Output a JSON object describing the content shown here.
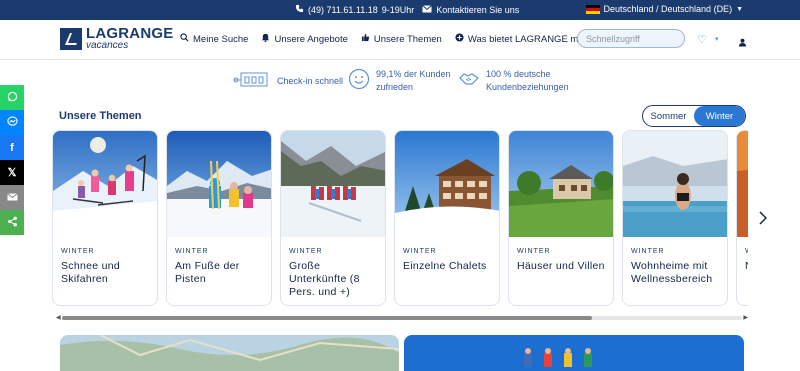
{
  "topbar": {
    "phone": "(49) 711.61.11.18",
    "hours": "9-19Uhr",
    "contact": "Kontaktieren Sie uns",
    "language": "Deutschland / Deutschland (DE)"
  },
  "header": {
    "logo_main": "LAGRANGE",
    "logo_sub": "vacances",
    "nav": [
      {
        "label": "Meine Suche",
        "icon": "search-icon"
      },
      {
        "label": "Unsere Angebote",
        "icon": "bell-icon"
      },
      {
        "label": "Unsere Themen",
        "icon": "thumb-icon"
      },
      {
        "label": "Was bietet LAGRANGE mehr?",
        "icon": "plus-circle-icon"
      }
    ],
    "search_placeholder": "Schnellzugriff"
  },
  "features": [
    {
      "line1": "Check-in schnell",
      "line2": ""
    },
    {
      "line1": "99,1% der Kunden",
      "line2": "zufrieden"
    },
    {
      "line1": "100 % deutsche",
      "line2": "Kundenbeziehungen"
    }
  ],
  "social": [
    "whatsapp",
    "messenger",
    "facebook",
    "x",
    "email",
    "share"
  ],
  "section": {
    "title": "Unsere Themen",
    "toggle": [
      "Sommer",
      "Winter"
    ],
    "active_toggle": "Winter"
  },
  "cards": [
    {
      "season": "WINTER",
      "name": "Schnee und Skifahren"
    },
    {
      "season": "WINTER",
      "name": "Am Fuße der Pisten"
    },
    {
      "season": "WINTER",
      "name": "Große Unterkünfte (8 Pers. und +)"
    },
    {
      "season": "WINTER",
      "name": "Einzelne Chalets"
    },
    {
      "season": "WINTER",
      "name": "Häuser und Villen"
    },
    {
      "season": "WINTER",
      "name": "Wohnheime mit Wellnessbereich"
    },
    {
      "season": "W",
      "name": "N"
    }
  ],
  "colors": {
    "navy": "#1b3b6f",
    "accent": "#2a78d4",
    "whatsapp": "#25d366",
    "messenger": "#0084ff",
    "facebook": "#1877f2",
    "x": "#000000",
    "email": "#888888",
    "share": "#4caf50"
  },
  "scroll": {
    "position_fraction": 0.78
  }
}
